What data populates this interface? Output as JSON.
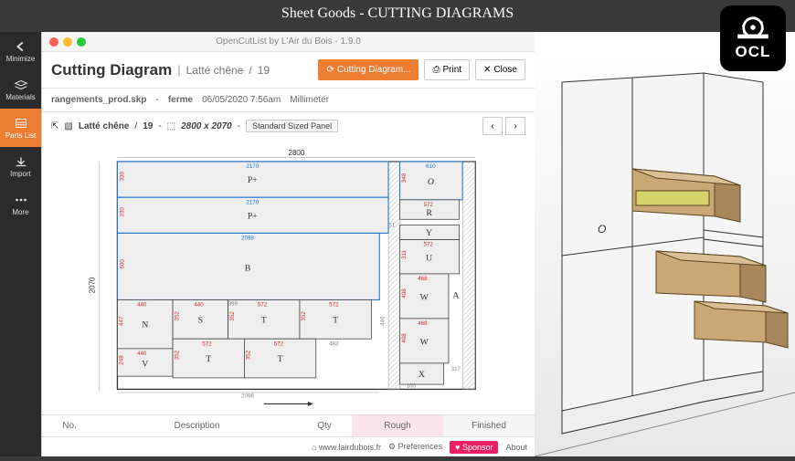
{
  "page_title": "Sheet Goods - CUTTING DIAGRAMS",
  "ocl_badge": "OCL",
  "window_title": "OpenCutList by L'Air du Bois - 1.9.0",
  "sidebar": {
    "items": [
      {
        "label": "Minimize"
      },
      {
        "label": "Materials"
      },
      {
        "label": "Parts List"
      },
      {
        "label": "Import"
      },
      {
        "label": "More"
      }
    ]
  },
  "header": {
    "title": "Cutting Diagram",
    "material": "Latté chêne",
    "count": "19",
    "btn_diagram": "Cutting Diagram...",
    "btn_print": "Print",
    "btn_close": "Close"
  },
  "subheader": {
    "file": "rangements_prod.skp",
    "model": "ferme",
    "date": "06/05/2020 7:56am",
    "unit": "Millimeter"
  },
  "panel": {
    "material": "Latté chêne",
    "count": "19",
    "size": "2800 x 2070",
    "tag": "Standard Sized Panel"
  },
  "diagram": {
    "width": "2800",
    "height": "2070",
    "width_bottom": "2098",
    "parts": [
      {
        "label": "P+",
        "w": "2170",
        "h": "330"
      },
      {
        "label": "P+",
        "w": "2170",
        "h": "330"
      },
      {
        "label": "B",
        "w": "2098",
        "h": "600"
      },
      {
        "label": "N",
        "w": "440",
        "h": "447"
      },
      {
        "label": "S",
        "w": "440",
        "h": "352"
      },
      {
        "label": "T",
        "w": "572",
        "h": "352"
      },
      {
        "label": "T",
        "w": "572",
        "h": "352"
      },
      {
        "label": "V",
        "w": "440",
        "h": "248"
      },
      {
        "label": "T",
        "w": "572",
        "h": "352"
      },
      {
        "label": "T",
        "w": "572",
        "h": "352"
      },
      {
        "label": "O",
        "w": "610",
        "h": "348"
      },
      {
        "label": "R",
        "w": "572",
        "h": ""
      },
      {
        "label": "Y",
        "w": "572",
        "h": ""
      },
      {
        "label": "U",
        "w": "572",
        "h": "311"
      },
      {
        "label": "W",
        "w": "468",
        "h": "408"
      },
      {
        "label": "W",
        "w": "468",
        "h": "408"
      },
      {
        "label": "X",
        "w": "",
        "h": ""
      },
      {
        "label": "A",
        "w": "",
        "h": ""
      }
    ],
    "extra_dims": [
      "51",
      "399",
      "483",
      "446",
      "317",
      "100"
    ]
  },
  "table": {
    "col_no": "No.",
    "col_desc": "Description",
    "col_qty": "Qty",
    "col_rough": "Rough",
    "col_finished": "Finished"
  },
  "footer": {
    "url": "www.lairdubois.fr",
    "prefs": "Preferences",
    "sponsor": "Sponsor",
    "about": "About"
  },
  "model_label": "O"
}
